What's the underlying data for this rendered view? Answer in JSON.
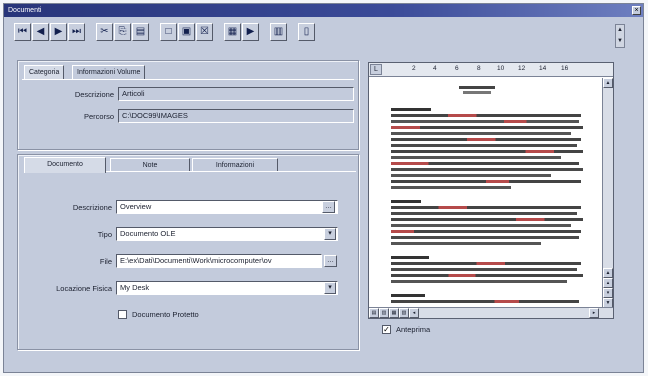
{
  "window": {
    "title": "Documenti"
  },
  "toolbar": {
    "icons": [
      "first-record-icon",
      "previous-record-icon",
      "next-record-icon",
      "last-record-icon",
      "cut-icon",
      "copy-icon",
      "paste-icon",
      "new-icon",
      "save-icon",
      "delete-icon",
      "find-icon",
      "play-icon",
      "list-icon",
      "exit-icon"
    ]
  },
  "category_tabs": [
    "Categoria",
    "Informazioni Volume"
  ],
  "category": {
    "description_label": "Descrizione",
    "description_value": "Articoli",
    "path_label": "Percorso",
    "path_value": "C:\\DOC99\\IMAGES"
  },
  "document_tabs": [
    "Documento",
    "Note",
    "Informazioni"
  ],
  "document": {
    "description_label": "Descrizione",
    "description_value": "Overview",
    "type_label": "Tipo",
    "type_value": "Documento OLE",
    "file_label": "File",
    "file_value": "E:\\ex\\Dati\\Documenti\\Work\\microcomputer\\ov",
    "location_label": "Locazione Fisica",
    "location_value": "My Desk",
    "protected_label": "Documento Protetto",
    "protected_checked": false
  },
  "preview": {
    "ruler_ticks": [
      "2",
      "4",
      "6",
      "8",
      "10",
      "12",
      "14",
      "16"
    ],
    "checkbox_label": "Anteprima",
    "checkbox_checked": true
  },
  "colors": {
    "window_bg": "#c3cbdc",
    "title_bar": "#28357a",
    "text_dark": "#1c2130",
    "text_red": "#b54a4a"
  }
}
